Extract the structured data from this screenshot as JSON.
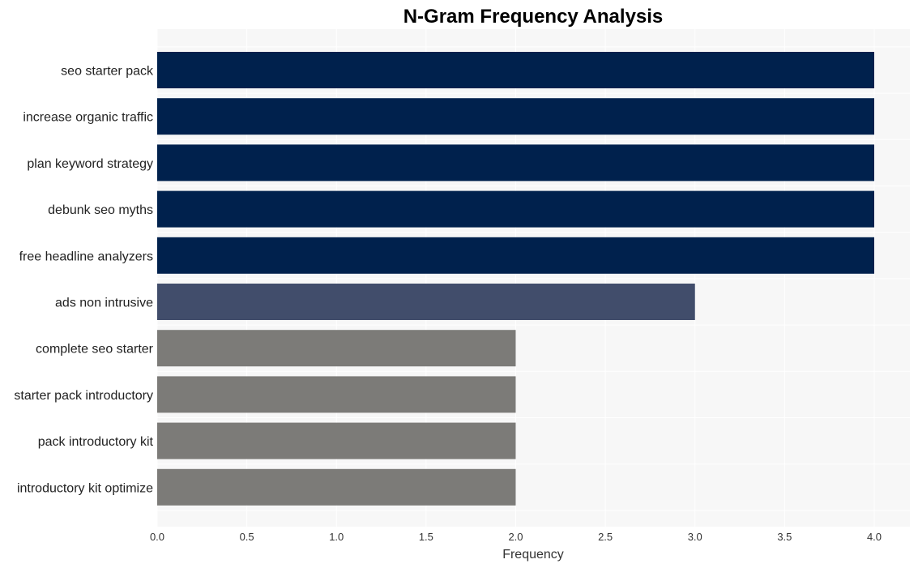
{
  "chart_data": {
    "type": "bar",
    "orientation": "horizontal",
    "title": "N-Gram Frequency Analysis",
    "xlabel": "Frequency",
    "ylabel": "",
    "xlim": [
      0,
      4.2
    ],
    "xticks": [
      0.0,
      0.5,
      1.0,
      1.5,
      2.0,
      2.5,
      3.0,
      3.5,
      4.0
    ],
    "xtick_labels": [
      "0.0",
      "0.5",
      "1.0",
      "1.5",
      "2.0",
      "2.5",
      "3.0",
      "3.5",
      "4.0"
    ],
    "grid": true,
    "categories": [
      "seo starter pack",
      "increase organic traffic",
      "plan keyword strategy",
      "debunk seo myths",
      "free headline analyzers",
      "ads non intrusive",
      "complete seo starter",
      "starter pack introductory",
      "pack introductory kit",
      "introductory kit optimize"
    ],
    "values": [
      4,
      4,
      4,
      4,
      4,
      3,
      2,
      2,
      2,
      2
    ],
    "colors": [
      "#00214d",
      "#00214d",
      "#00214d",
      "#00214d",
      "#00214d",
      "#414d6b",
      "#7c7b78",
      "#7c7b78",
      "#7c7b78",
      "#7c7b78"
    ],
    "background": "#f7f7f7"
  }
}
